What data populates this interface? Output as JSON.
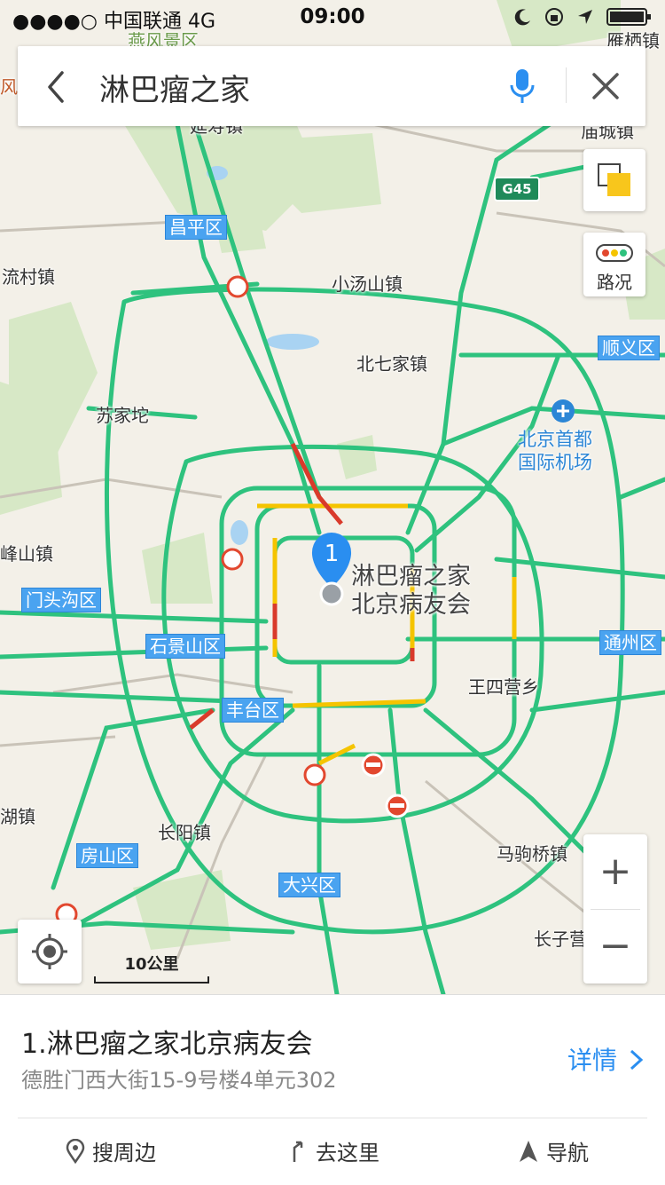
{
  "status_bar": {
    "carrier": "●●●●○ 中国联通",
    "network": "4G",
    "time": "09:00"
  },
  "search": {
    "query": "淋巴瘤之家"
  },
  "controls": {
    "traffic_label": "路况",
    "zoom_in": "+",
    "zoom_out": "−"
  },
  "scale": {
    "label": "10公里"
  },
  "map": {
    "place_labels": [
      "雁栖镇",
      "庙城镇",
      "延寿镇",
      "小汤山镇",
      "流村镇",
      "北七家镇",
      "苏家坨",
      "峰山镇",
      "王四营乡",
      "长阳镇",
      "马驹桥镇",
      "长子营",
      "湖镇"
    ],
    "district_labels": [
      "昌平区",
      "顺义区",
      "门头沟区",
      "石景山区",
      "通州区",
      "丰台区",
      "房山区",
      "大兴区"
    ],
    "highway_shield": "G45",
    "airport_label_line1": "北京首都",
    "airport_label_line2": "国际机场",
    "marker_number": "1",
    "poi_line1": "淋巴瘤之家",
    "poi_line2": "北京病友会",
    "partial_top_label": "燕风景区",
    "partial_left_label": "风景"
  },
  "result": {
    "name": "1.淋巴瘤之家北京病友会",
    "address": "德胜门西大街15-9号楼4单元302",
    "detail_label": "详情"
  },
  "actions": [
    {
      "label": "搜周边",
      "icon": "location-pin-icon"
    },
    {
      "label": "去这里",
      "icon": "route-arrow-icon"
    },
    {
      "label": "导航",
      "icon": "navigation-arrow-icon"
    }
  ],
  "colors": {
    "road_green": "#2ec27e",
    "road_yellow": "#f5c400",
    "road_red": "#d93a2b",
    "district_blue": "#4aa3f0",
    "accent_blue": "#2a8ef0"
  }
}
